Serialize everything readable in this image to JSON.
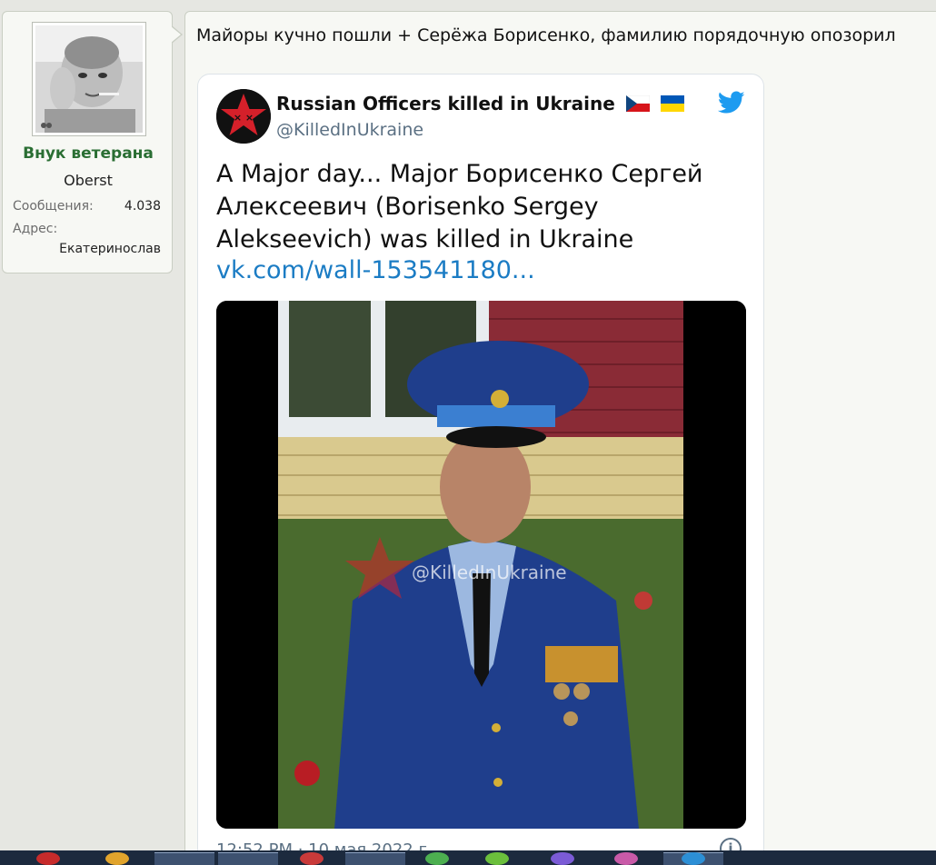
{
  "user": {
    "name": "Внук ветерана",
    "title": "Oberst",
    "messages_label": "Сообщения:",
    "messages_value": "4.038",
    "address_label": "Адрес:",
    "address_value": "Екатеринослав",
    "avatar_icon": "baby-avatar-icon"
  },
  "post": {
    "text": "Майоры кучно пошли + Серёжа Борисенко, фамилию порядочную опозорил"
  },
  "tweet": {
    "display_name": "Russian Officers killed in Ukraine",
    "handle": "@KilledInUkraine",
    "body": "A Major day... Major Борисенко Сергей Алексеевич (Borisenko Sergey Alekseevich) was killed in Ukraine",
    "link": "vk.com/wall-153541180...",
    "timestamp": "12:52 PM · 10 мая 2022 г.",
    "watermark": "@KilledInUkraine",
    "info_label": "i",
    "accent_color": "#1d9bf0",
    "link_color": "#1b7cc4",
    "flags": [
      "czech-flag-icon",
      "ukraine-flag-icon"
    ]
  },
  "colors": {
    "username": "#2a6e33",
    "page_bg": "#e6e7e2",
    "panel_bg": "#f7f8f4"
  }
}
